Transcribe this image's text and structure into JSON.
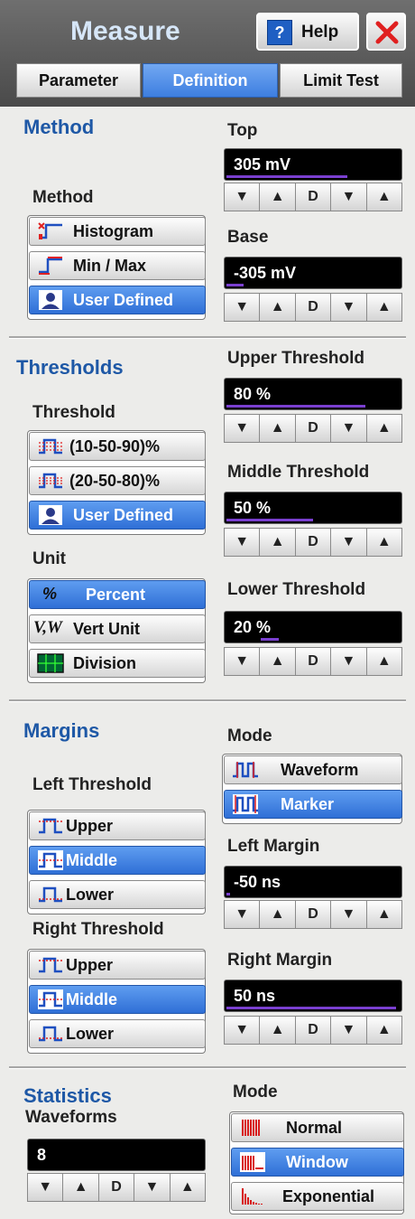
{
  "header": {
    "title": "Measure",
    "help_label": "Help",
    "help_icon": "help-icon",
    "close_icon": "close-icon"
  },
  "tabs": [
    {
      "label": "Parameter",
      "selected": false
    },
    {
      "label": "Definition",
      "selected": true
    },
    {
      "label": "Limit Test",
      "selected": false
    }
  ],
  "method": {
    "heading": "Method",
    "label": "Method",
    "options": [
      {
        "label": "Histogram",
        "icon": "histogram-step-icon",
        "selected": false
      },
      {
        "label": "Min / Max",
        "icon": "min-max-step-icon",
        "selected": false
      },
      {
        "label": "User Defined",
        "icon": "user-icon",
        "selected": true
      }
    ],
    "top": {
      "label": "Top",
      "value": "305 mV",
      "fill": 0.7
    },
    "base": {
      "label": "Base",
      "value": "-305 mV",
      "fill": 0.1
    }
  },
  "thresholds": {
    "heading": "Thresholds",
    "label": "Threshold",
    "options": [
      {
        "label": "(10-50-90)%",
        "icon": "threshold-pulse-icon",
        "selected": false
      },
      {
        "label": "(20-50-80)%",
        "icon": "threshold-pulse-icon",
        "selected": false
      },
      {
        "label": "User Defined",
        "icon": "user-icon",
        "selected": true
      }
    ],
    "unit_label": "Unit",
    "units": [
      {
        "label": "Percent",
        "icon": "percent-icon",
        "selected": true
      },
      {
        "label": "Vert Unit",
        "icon": "vw-icon",
        "selected": false
      },
      {
        "label": "Division",
        "icon": "division-grid-icon",
        "selected": false
      }
    ],
    "upper": {
      "label": "Upper Threshold",
      "value": "80 %",
      "fill": 0.8
    },
    "middle": {
      "label": "Middle Threshold",
      "value": "50 %",
      "fill": 0.5
    },
    "lower": {
      "label": "Lower Threshold",
      "value": "20 %",
      "fill": 0.2
    }
  },
  "margins": {
    "heading": "Margins",
    "left_threshold_label": "Left Threshold",
    "left_options": [
      {
        "label": "Upper",
        "selected": false
      },
      {
        "label": "Middle",
        "selected": true
      },
      {
        "label": "Lower",
        "selected": false
      }
    ],
    "right_threshold_label": "Right Threshold",
    "right_options": [
      {
        "label": "Upper",
        "selected": false
      },
      {
        "label": "Middle",
        "selected": true
      },
      {
        "label": "Lower",
        "selected": false
      }
    ],
    "mode_label": "Mode",
    "modes": [
      {
        "label": "Waveform",
        "icon": "waveform-pulse-icon",
        "selected": false
      },
      {
        "label": "Marker",
        "icon": "marker-pulse-icon",
        "selected": true
      }
    ],
    "left_margin": {
      "label": "Left Margin",
      "value": "-50 ns",
      "fill": 0.02
    },
    "right_margin": {
      "label": "Right Margin",
      "value": "50 ns",
      "fill": 0.98
    }
  },
  "statistics": {
    "heading": "Statistics",
    "waveforms_label": "Waveforms",
    "waveforms_value": "8",
    "mode_label": "Mode",
    "modes": [
      {
        "label": "Normal",
        "icon": "normal-bars-icon",
        "selected": false
      },
      {
        "label": "Window",
        "icon": "window-bars-icon",
        "selected": true
      },
      {
        "label": "Exponential",
        "icon": "exponential-bars-icon",
        "selected": false
      }
    ]
  },
  "spinner": {
    "down": "▼",
    "up": "▲",
    "default": "D"
  },
  "colors": {
    "accent": "#3d7ee0",
    "heading": "#1e58a6",
    "indicator": "#7a3fd0"
  }
}
